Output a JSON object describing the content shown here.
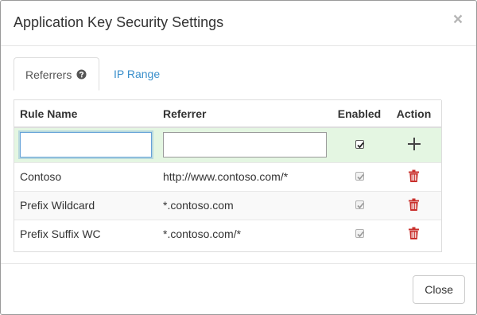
{
  "dialog": {
    "title": "Application Key Security Settings",
    "close_glyph": "×"
  },
  "tabs": [
    {
      "label": "Referrers",
      "active": true,
      "icon": "question-circle-icon"
    },
    {
      "label": "IP Range",
      "active": false
    }
  ],
  "table": {
    "columns": [
      "Rule Name",
      "Referrer",
      "Enabled",
      "Action"
    ],
    "new_row": {
      "rule_name_value": "",
      "referrer_value": "",
      "enabled": true,
      "action_icon": "plus-icon"
    },
    "rows": [
      {
        "rule_name": "Contoso",
        "referrer": "http://www.contoso.com/*",
        "enabled": true,
        "action_icon": "trash-icon"
      },
      {
        "rule_name": "Prefix Wildcard",
        "referrer": "*.contoso.com",
        "enabled": true,
        "action_icon": "trash-icon"
      },
      {
        "rule_name": "Prefix Suffix WC",
        "referrer": "*.contoso.com/*",
        "enabled": true,
        "action_icon": "trash-icon"
      }
    ]
  },
  "footer": {
    "close_label": "Close"
  },
  "colors": {
    "link": "#3a8fcb",
    "new_row_bg": "#e4f6e2",
    "delete": "#c9302c",
    "focus": "#66a3d8"
  }
}
